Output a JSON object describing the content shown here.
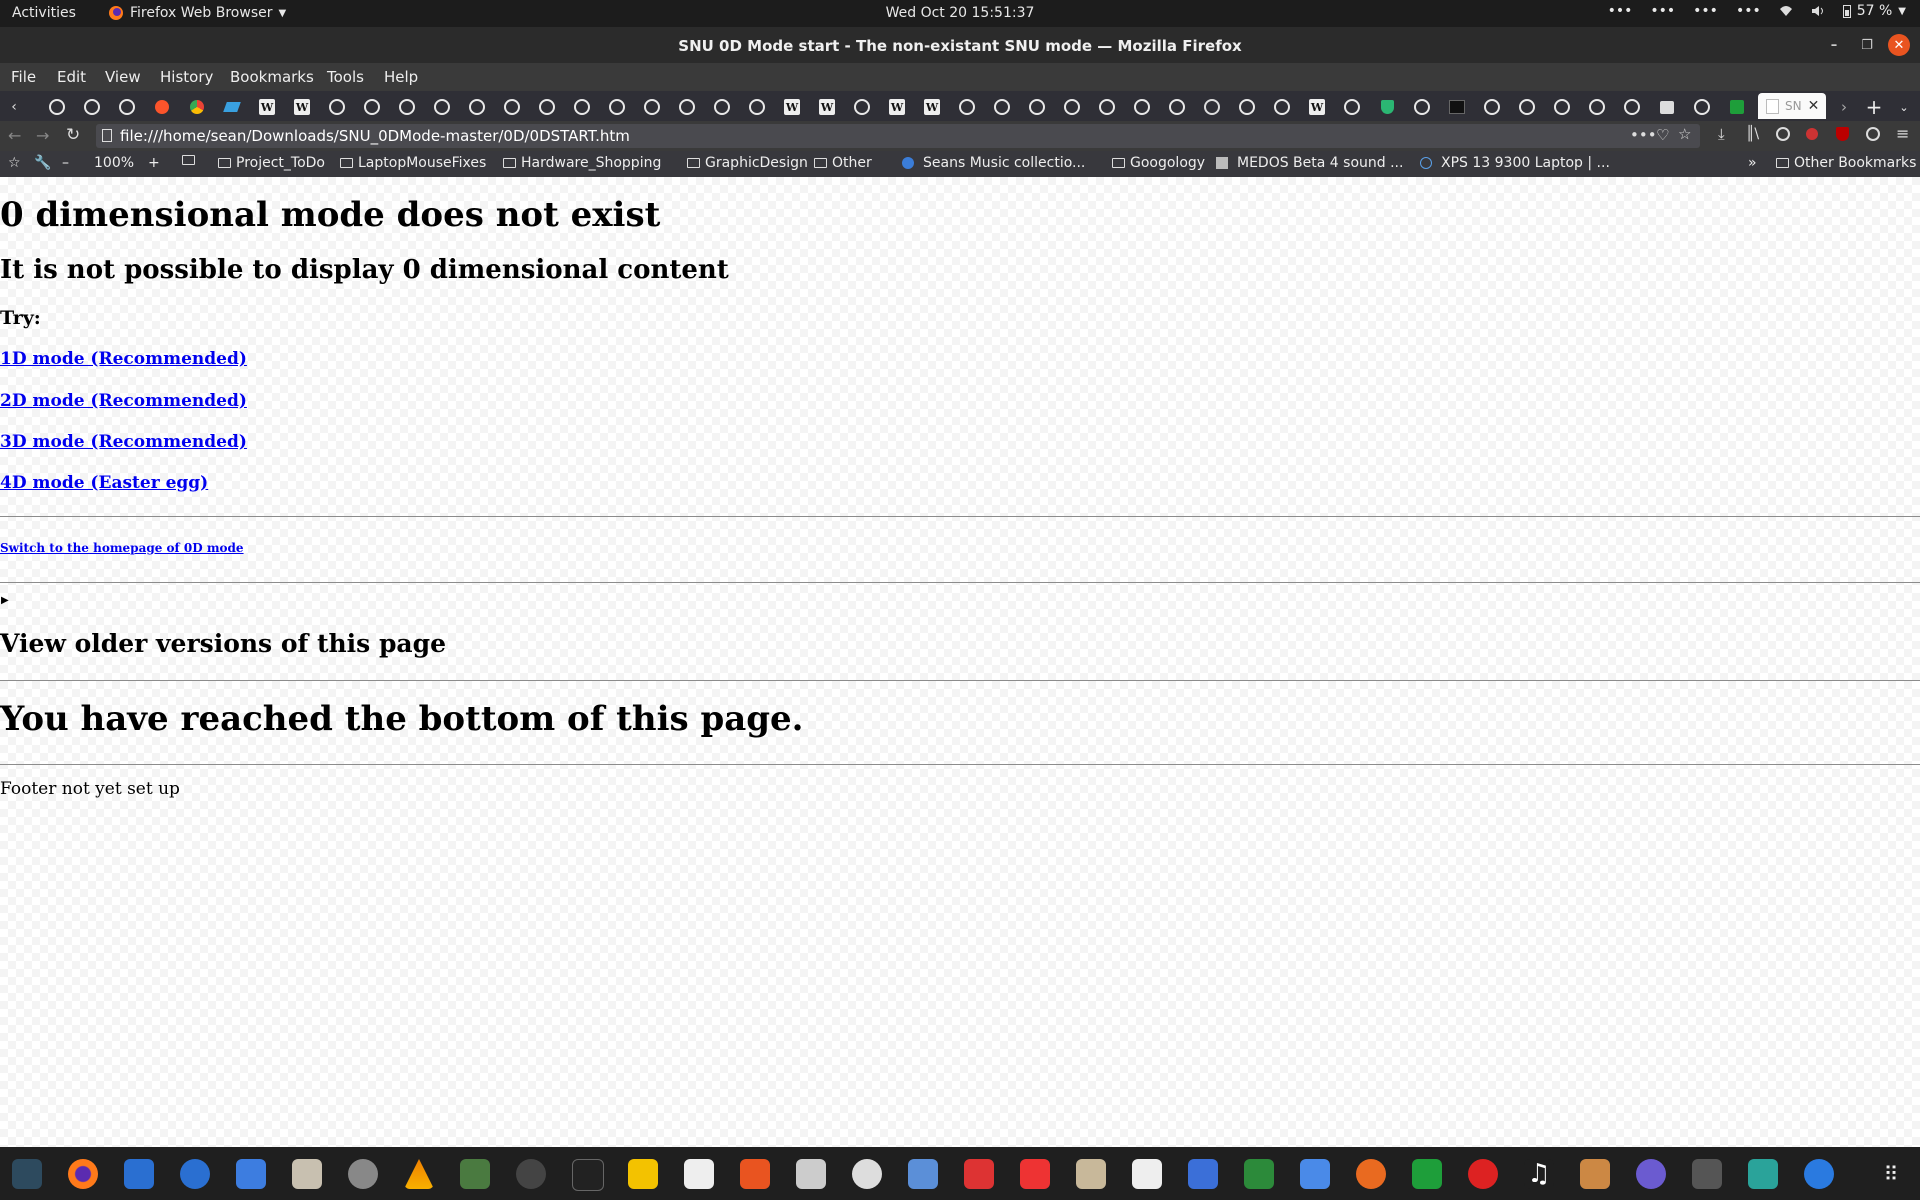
{
  "topbar": {
    "activities": "Activities",
    "app_menu": "Firefox Web Browser",
    "clock": "Wed Oct 20  15:51:37",
    "battery": "57 %"
  },
  "window": {
    "title": "SNU 0D Mode start - The non-existant SNU mode — Mozilla Firefox"
  },
  "menubar": {
    "items": [
      "File",
      "Edit",
      "View",
      "History",
      "Bookmarks",
      "Tools",
      "Help"
    ]
  },
  "tabstrip": {
    "active_tab_label": "SN"
  },
  "navbar": {
    "url": "file:///home/sean/Downloads/SNU_0DMode-master/0D/0DSTART.htm",
    "page_actions_icon": "more-horizontal-icon"
  },
  "bookmarks_toolbar": {
    "zoom": "100%",
    "items": [
      "Project_ToDo",
      "LaptopMouseFixes",
      "Hardware_Shopping",
      "GraphicDesign",
      "Other",
      "Seans Music collectio...",
      "Googology",
      "MEDOS Beta 4 sound ...",
      "XPS 13 9300 Laptop | ..."
    ],
    "other_bookmarks": "Other Bookmarks"
  },
  "page": {
    "heading": "0 dimensional mode does not exist",
    "subheading": "It is not possible to display 0 dimensional content",
    "try_label": "Try:",
    "links": [
      "1D mode (Recommended)",
      "2D mode (Recommended)",
      "3D mode (Recommended)",
      "4D mode (Easter egg)"
    ],
    "homepage_link": "Switch to the homepage of 0D mode",
    "older_versions_heading": "View older versions of this page",
    "bottom_heading": "You have reached the bottom of this page.",
    "footer": "Footer not yet set up"
  },
  "colors": {
    "link": "#0000ee",
    "top_bar": "#1c1c1c",
    "close_button": "#e95420"
  }
}
